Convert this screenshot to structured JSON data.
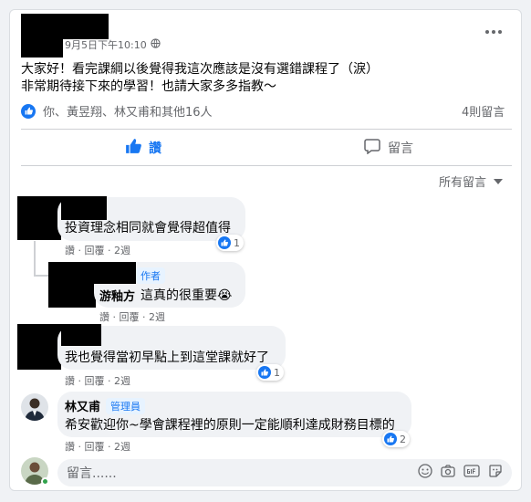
{
  "post": {
    "timestamp": "9月5日下午10:10",
    "more_label": "···",
    "text_line1": "大家好！看完課綱以後覺得我這次應該是沒有選錯課程了（淚）",
    "text_line2": "非常期待接下來的學習！也請大家多多指教～",
    "reactions_summary": "你、黃昱翔、林又甫和其他16人",
    "comment_count": "4則留言",
    "like_label": "讚",
    "comment_label": "留言",
    "sort_label": "所有留言"
  },
  "comments": [
    {
      "text": "投資理念相同就會覺得超值得",
      "actions": "讚 · 回覆 · 2週",
      "reactions": "1"
    },
    {
      "badge": "作者",
      "name": "游釉方",
      "text": "這真的很重要😭",
      "actions": "讚 · 回覆 · 2週"
    },
    {
      "text": "我也覺得當初早點上到這堂課就好了",
      "actions": "讚 · 回覆 · 2週",
      "reactions": "1"
    },
    {
      "name": "林又甫",
      "badge": "管理員",
      "text": "希安歡迎你~學會課程裡的原則一定能順利達成財務目標的",
      "actions": "讚 · 回覆 · 2週",
      "reactions": "2"
    }
  ],
  "composer": {
    "placeholder": "留言......"
  },
  "colors": {
    "accent": "#1877f2",
    "secondary_text": "#65676b",
    "bubble": "#f0f2f5"
  },
  "icons": [
    "globe-icon",
    "more-icon",
    "like-icon",
    "comment-icon",
    "dropdown-icon",
    "emoji-icon",
    "camera-icon",
    "gif-icon",
    "sticker-icon"
  ]
}
